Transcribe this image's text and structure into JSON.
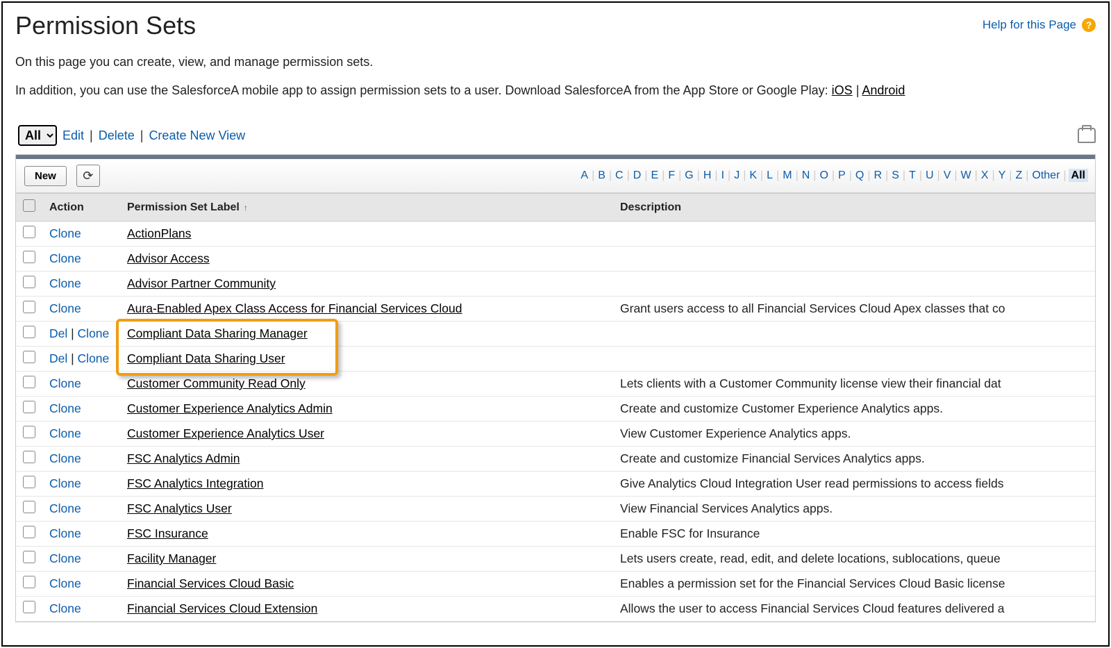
{
  "header": {
    "title": "Permission Sets",
    "help_label": "Help for this Page"
  },
  "intro": {
    "line1": "On this page you can create, view, and manage permission sets.",
    "line2_pre": "In addition, you can use the SalesforceA mobile app to assign permission sets to a user. Download SalesforceA from the App Store or Google Play: ",
    "ios": "iOS",
    "android": "Android"
  },
  "view": {
    "selected": "All",
    "edit": "Edit",
    "del": "Delete",
    "create": "Create New View"
  },
  "toolbar": {
    "new_label": "New"
  },
  "alpha": {
    "letters": [
      "A",
      "B",
      "C",
      "D",
      "E",
      "F",
      "G",
      "H",
      "I",
      "J",
      "K",
      "L",
      "M",
      "N",
      "O",
      "P",
      "Q",
      "R",
      "S",
      "T",
      "U",
      "V",
      "W",
      "X",
      "Y",
      "Z"
    ],
    "extra": [
      "Other",
      "All"
    ],
    "active": "All"
  },
  "columns": {
    "action": "Action",
    "label": "Permission Set Label",
    "description": "Description"
  },
  "action_labels": {
    "clone": "Clone",
    "del": "Del"
  },
  "rows": [
    {
      "actions": [
        "clone"
      ],
      "label": "ActionPlans",
      "description": ""
    },
    {
      "actions": [
        "clone"
      ],
      "label": "Advisor Access",
      "description": ""
    },
    {
      "actions": [
        "clone"
      ],
      "label": "Advisor Partner Community",
      "description": ""
    },
    {
      "actions": [
        "clone"
      ],
      "label": "Aura-Enabled Apex Class Access for Financial Services Cloud",
      "description": "Grant users access to all Financial Services Cloud Apex classes that co"
    },
    {
      "actions": [
        "del",
        "clone"
      ],
      "label": "Compliant Data Sharing Manager",
      "description": ""
    },
    {
      "actions": [
        "del",
        "clone"
      ],
      "label": "Compliant Data Sharing User",
      "description": ""
    },
    {
      "actions": [
        "clone"
      ],
      "label": "Customer Community Read Only",
      "description": "Lets clients with a Customer Community license view their financial dat"
    },
    {
      "actions": [
        "clone"
      ],
      "label": "Customer Experience Analytics Admin",
      "description": "Create and customize Customer Experience Analytics apps."
    },
    {
      "actions": [
        "clone"
      ],
      "label": "Customer Experience Analytics User",
      "description": "View Customer Experience Analytics apps."
    },
    {
      "actions": [
        "clone"
      ],
      "label": "FSC Analytics Admin",
      "description": "Create and customize Financial Services Analytics apps."
    },
    {
      "actions": [
        "clone"
      ],
      "label": "FSC Analytics Integration",
      "description": "Give Analytics Cloud Integration User read permissions to access fields"
    },
    {
      "actions": [
        "clone"
      ],
      "label": "FSC Analytics User",
      "description": "View Financial Services Analytics apps."
    },
    {
      "actions": [
        "clone"
      ],
      "label": "FSC Insurance",
      "description": "Enable FSC for Insurance"
    },
    {
      "actions": [
        "clone"
      ],
      "label": "Facility Manager",
      "description": "Lets users create, read, edit, and delete locations, sublocations, queue"
    },
    {
      "actions": [
        "clone"
      ],
      "label": "Financial Services Cloud Basic",
      "description": "Enables a permission set for the Financial Services Cloud Basic license"
    },
    {
      "actions": [
        "clone"
      ],
      "label": "Financial Services Cloud Extension",
      "description": "Allows the user to access Financial Services Cloud features delivered a"
    }
  ],
  "highlight": {
    "row_start": 4,
    "row_end": 5
  }
}
